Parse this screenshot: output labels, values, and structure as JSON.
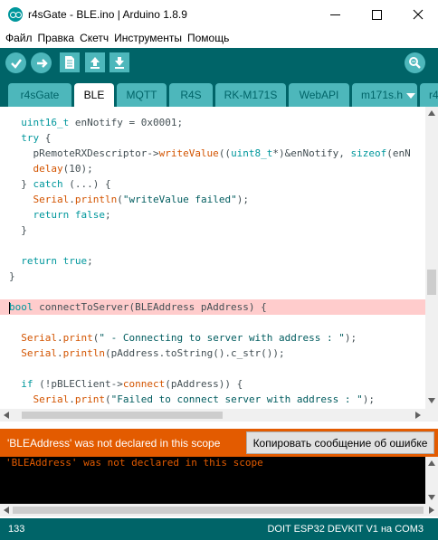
{
  "window": {
    "title": "r4sGate - BLE.ino | Arduino 1.8.9"
  },
  "menu": {
    "items": [
      "Файл",
      "Правка",
      "Скетч",
      "Инструменты",
      "Помощь"
    ]
  },
  "toolbar": {
    "buttons": [
      "verify-icon",
      "upload-icon",
      "new-icon",
      "open-icon",
      "save-icon"
    ],
    "monitor": "serial-monitor-icon"
  },
  "tabs": [
    "r4sGate",
    "BLE",
    "MQTT",
    "R4S",
    "RK-M171S",
    "WebAPI",
    "m171s.h",
    "r4"
  ],
  "active_tab": "BLE",
  "code": [
    "  uint16_t enNotify = 0x0001;",
    "  try {",
    "    pRemoteRXDescriptor->writeValue((uint8_t*)&enNotify, sizeof(enN",
    "    delay(10);",
    "  } catch (...) {",
    "    Serial.println(\"writeValue failed\");",
    "    return false;",
    "  }",
    "",
    "  return true;",
    "}",
    "",
    "bool connectToServer(BLEAddress pAddress) {",
    "",
    "  Serial.print(\" - Connecting to server with address : \");",
    "  Serial.println(pAddress.toString().c_str());",
    "",
    "  if (!pBLEClient->connect(pAddress)) {",
    "    Serial.print(\"Failed to connect server with address : \");"
  ],
  "error_bar": {
    "message": "'BLEAddress' was not declared in this scope",
    "copy_button": "Копировать сообщение об ошибке"
  },
  "console": {
    "text": "'BLEAddress' was not declared in this scope"
  },
  "status": {
    "line": "133",
    "board": "DOIT ESP32 DEVKIT V1 на COM3"
  },
  "colors": {
    "toolbar": "#006468",
    "button": "#4db7bb",
    "error": "#e35b00",
    "highlight": "#ffcccc"
  }
}
